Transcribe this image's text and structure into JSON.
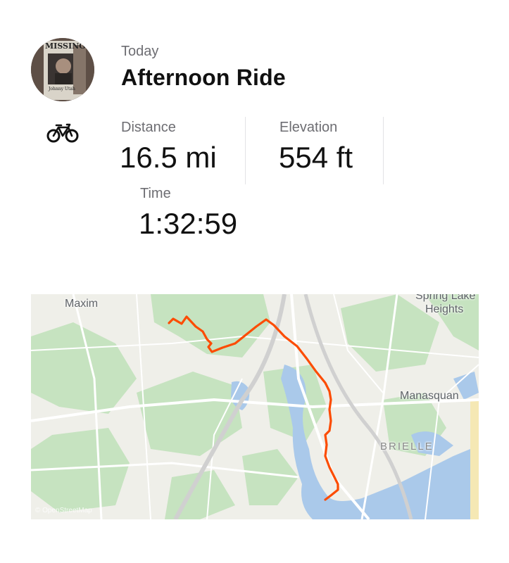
{
  "header": {
    "date_label": "Today",
    "activity_title": "Afternoon Ride",
    "activity_icon": "bicycle-icon",
    "avatar_text": "MISSING",
    "avatar_caption": "Johnny Utah"
  },
  "stats": {
    "distance": {
      "label": "Distance",
      "value": "16.5 mi"
    },
    "elevation": {
      "label": "Elevation",
      "value": "554 ft"
    },
    "time": {
      "label": "Time",
      "value": "1:32:59"
    }
  },
  "map": {
    "labels": {
      "maxim": "Maxim",
      "spring_lake": "Spring Lake",
      "heights": "Heights",
      "manasquan": "Manasquan",
      "brielle": "BRIELLE"
    },
    "attribution": "© OpenStreetMap",
    "colors": {
      "route": "#fc4c02",
      "water": "#aac9ea",
      "park": "#c6e3c0",
      "land": "#efefe9"
    }
  }
}
